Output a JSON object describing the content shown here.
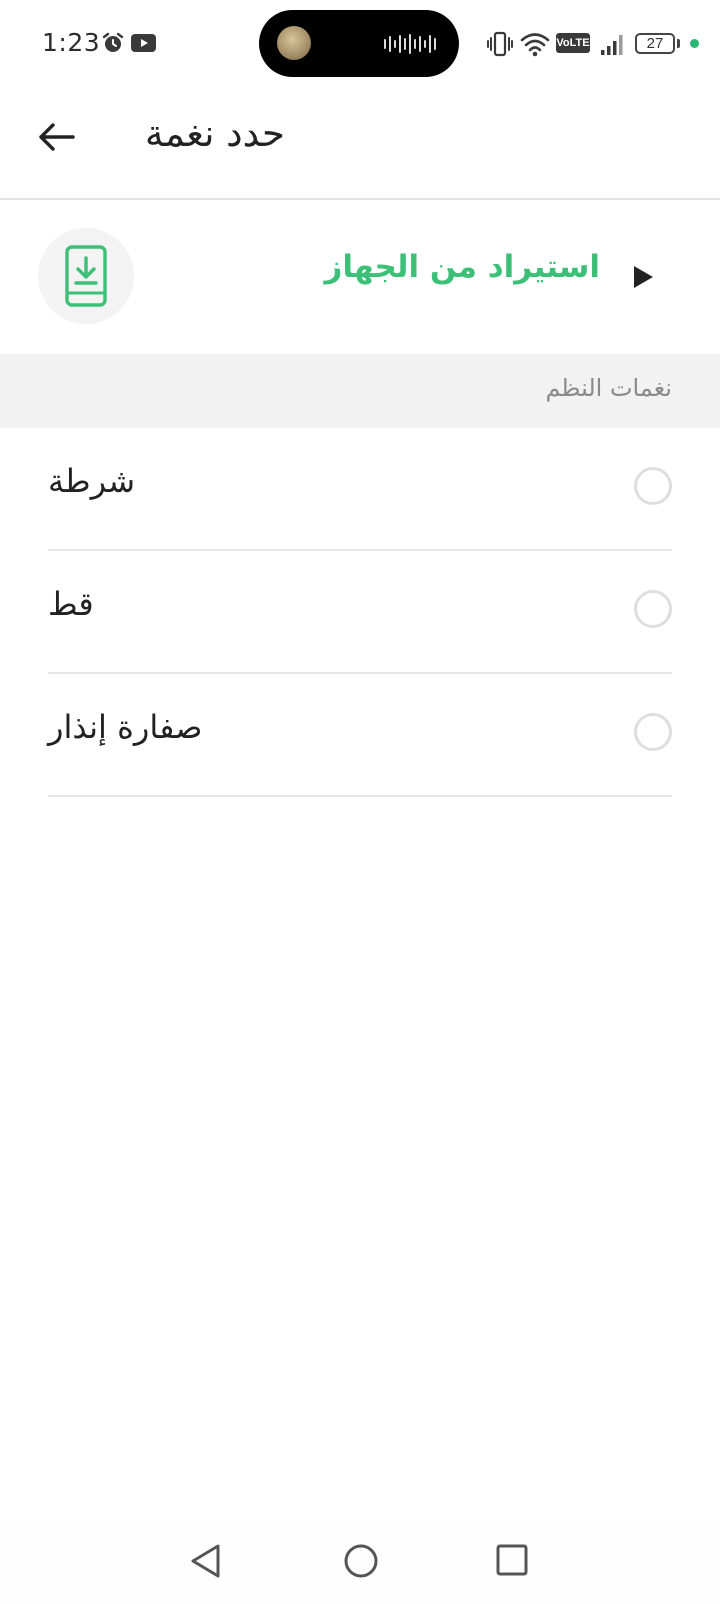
{
  "status_bar": {
    "time": "1:23",
    "battery_level": "27",
    "network_badge": "VoLTE",
    "icons": [
      "alarm-icon",
      "youtube-icon",
      "vibrate-icon",
      "wifi-icon",
      "volte-icon",
      "signal-icon",
      "battery-icon"
    ]
  },
  "app_bar": {
    "title": "حدد نغمة",
    "back_icon": "arrow-left-icon"
  },
  "import": {
    "label": "استيراد من الجهاز",
    "icon": "phone-download-icon",
    "accent_color": "#3dbf78"
  },
  "section": {
    "title": "نغمات النظم"
  },
  "tones": [
    {
      "label": "شرطة",
      "selected": false
    },
    {
      "label": "قط",
      "selected": false
    },
    {
      "label": "صفارة إنذار",
      "selected": false
    }
  ],
  "nav_bar": {
    "icons": [
      "nav-back-icon",
      "nav-home-icon",
      "nav-recents-icon"
    ]
  }
}
